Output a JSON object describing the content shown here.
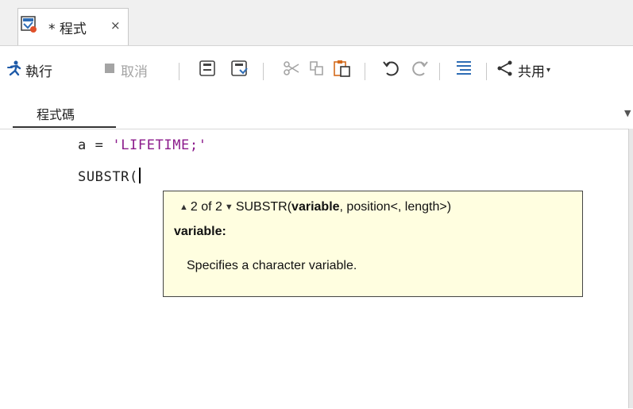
{
  "tab": {
    "title": "* 程式",
    "close": "×",
    "icon": "program-icon"
  },
  "toolbar": {
    "run_label": "執行",
    "cancel_label": "取消",
    "share_label": "共用"
  },
  "subtab": {
    "label": "程式碼",
    "menu": "▼"
  },
  "editor": {
    "line1": {
      "ident": "a",
      "op": " = ",
      "string": "'LIFETIME;'"
    },
    "line2": {
      "text": "SUBSTR("
    }
  },
  "tooltip": {
    "up_arrow": "▲",
    "counter": "2 of 2",
    "down_arrow": "▼",
    "sig_func": "SUBSTR(",
    "sig_param_bold": "variable",
    "sig_rest": ", position<, length>)",
    "param_name": "variable:",
    "description": "Specifies a character variable."
  },
  "colors": {
    "string": "#8b1a8b",
    "tooltip_bg": "#fffee0",
    "run_icon": "#1e5aa8"
  }
}
